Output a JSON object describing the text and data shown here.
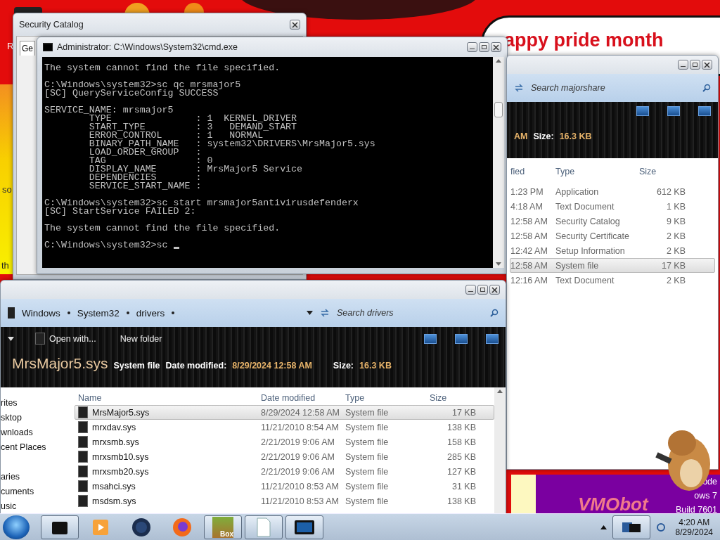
{
  "desktop": {
    "banner": "appy pride month",
    "fragments": [
      "R",
      "so",
      "th"
    ],
    "wordmark": "VMObot",
    "watermark": [
      "ode",
      "ows 7",
      "Build 7601"
    ]
  },
  "security_catalog": {
    "title": "Security Catalog",
    "tab": "Ge"
  },
  "cmd": {
    "title": "Administrator: C:\\Windows\\System32\\cmd.exe",
    "blocks": [
      [
        "The system cannot find the file specified."
      ],
      [
        "C:\\Windows\\system32>sc qc mrsmajor5",
        "[SC] QueryServiceConfig SUCCESS"
      ],
      [
        "SERVICE_NAME: mrsmajor5",
        "        TYPE               : 1  KERNEL_DRIVER",
        "        START_TYPE         : 3   DEMAND_START",
        "        ERROR_CONTROL      : 1   NORMAL",
        "        BINARY_PATH_NAME   : system32\\DRIVERS\\MrsMajor5.sys",
        "        LOAD_ORDER_GROUP   :",
        "        TAG                : 0",
        "        DISPLAY_NAME       : MrsMajor5 Service",
        "        DEPENDENCIES       :",
        "        SERVICE_START_NAME :"
      ],
      [
        "C:\\Windows\\system32>sc start mrsmajor5antivirusdefenderx",
        "[SC] StartService FAILED 2:"
      ],
      [
        "The system cannot find the file specified."
      ],
      [
        "C:\\Windows\\system32>sc"
      ]
    ]
  },
  "explorer_back": {
    "search": {
      "placeholder": "Search majorshare"
    },
    "details": {
      "date_fragment": "AM",
      "size_label": "Size:",
      "size": "16.3 KB"
    },
    "columns": [
      "fied",
      "Type",
      "Size"
    ],
    "rows": [
      {
        "modified": "1:23 PM",
        "type": "Application",
        "size": "612 KB",
        "selected": false
      },
      {
        "modified": "4:18 AM",
        "type": "Text Document",
        "size": "1 KB",
        "selected": false
      },
      {
        "modified": "12:58 AM",
        "type": "Security Catalog",
        "size": "9 KB",
        "selected": false
      },
      {
        "modified": "12:58 AM",
        "type": "Security Certificate",
        "size": "2 KB",
        "selected": false
      },
      {
        "modified": "12:42 AM",
        "type": "Setup Information",
        "size": "2 KB",
        "selected": false
      },
      {
        "modified": "12:58 AM",
        "type": "System file",
        "size": "17 KB",
        "selected": true
      },
      {
        "modified": "12:16 AM",
        "type": "Text Document",
        "size": "2 KB",
        "selected": false
      }
    ]
  },
  "explorer_front": {
    "breadcrumbs": [
      "Windows",
      "System32",
      "drivers"
    ],
    "search": {
      "placeholder": "Search drivers"
    },
    "toolbar": [
      "Open with...",
      "New folder"
    ],
    "details": {
      "name": "MrsMajor5.sys",
      "type": "System file",
      "date_label": "Date modified:",
      "date": "8/29/2024 12:58 AM",
      "size_label": "Size:",
      "size": "16.3 KB"
    },
    "nav": [
      "rites",
      "sktop",
      "wnloads",
      "cent Places",
      "aries",
      "cuments",
      "usic"
    ],
    "columns": [
      "Name",
      "Date modified",
      "Type",
      "Size"
    ],
    "rows": [
      {
        "name": "MrsMajor5.sys",
        "modified": "8/29/2024 12:58 AM",
        "type": "System file",
        "size": "17 KB",
        "selected": true
      },
      {
        "name": "mrxdav.sys",
        "modified": "11/21/2010 8:54 AM",
        "type": "System file",
        "size": "138 KB",
        "selected": false
      },
      {
        "name": "mrxsmb.sys",
        "modified": "2/21/2019 9:06 AM",
        "type": "System file",
        "size": "158 KB",
        "selected": false
      },
      {
        "name": "mrxsmb10.sys",
        "modified": "2/21/2019 9:06 AM",
        "type": "System file",
        "size": "285 KB",
        "selected": false
      },
      {
        "name": "mrxsmb20.sys",
        "modified": "2/21/2019 9:06 AM",
        "type": "System file",
        "size": "127 KB",
        "selected": false
      },
      {
        "name": "msahci.sys",
        "modified": "11/21/2010 8:53 AM",
        "type": "System file",
        "size": "31 KB",
        "selected": false
      },
      {
        "name": "msdsm.sys",
        "modified": "11/21/2010 8:53 AM",
        "type": "System file",
        "size": "138 KB",
        "selected": false
      }
    ]
  },
  "taskbar": {
    "box_label": "Box",
    "clock": {
      "time": "4:20 AM",
      "date": "8/29/2024"
    }
  }
}
